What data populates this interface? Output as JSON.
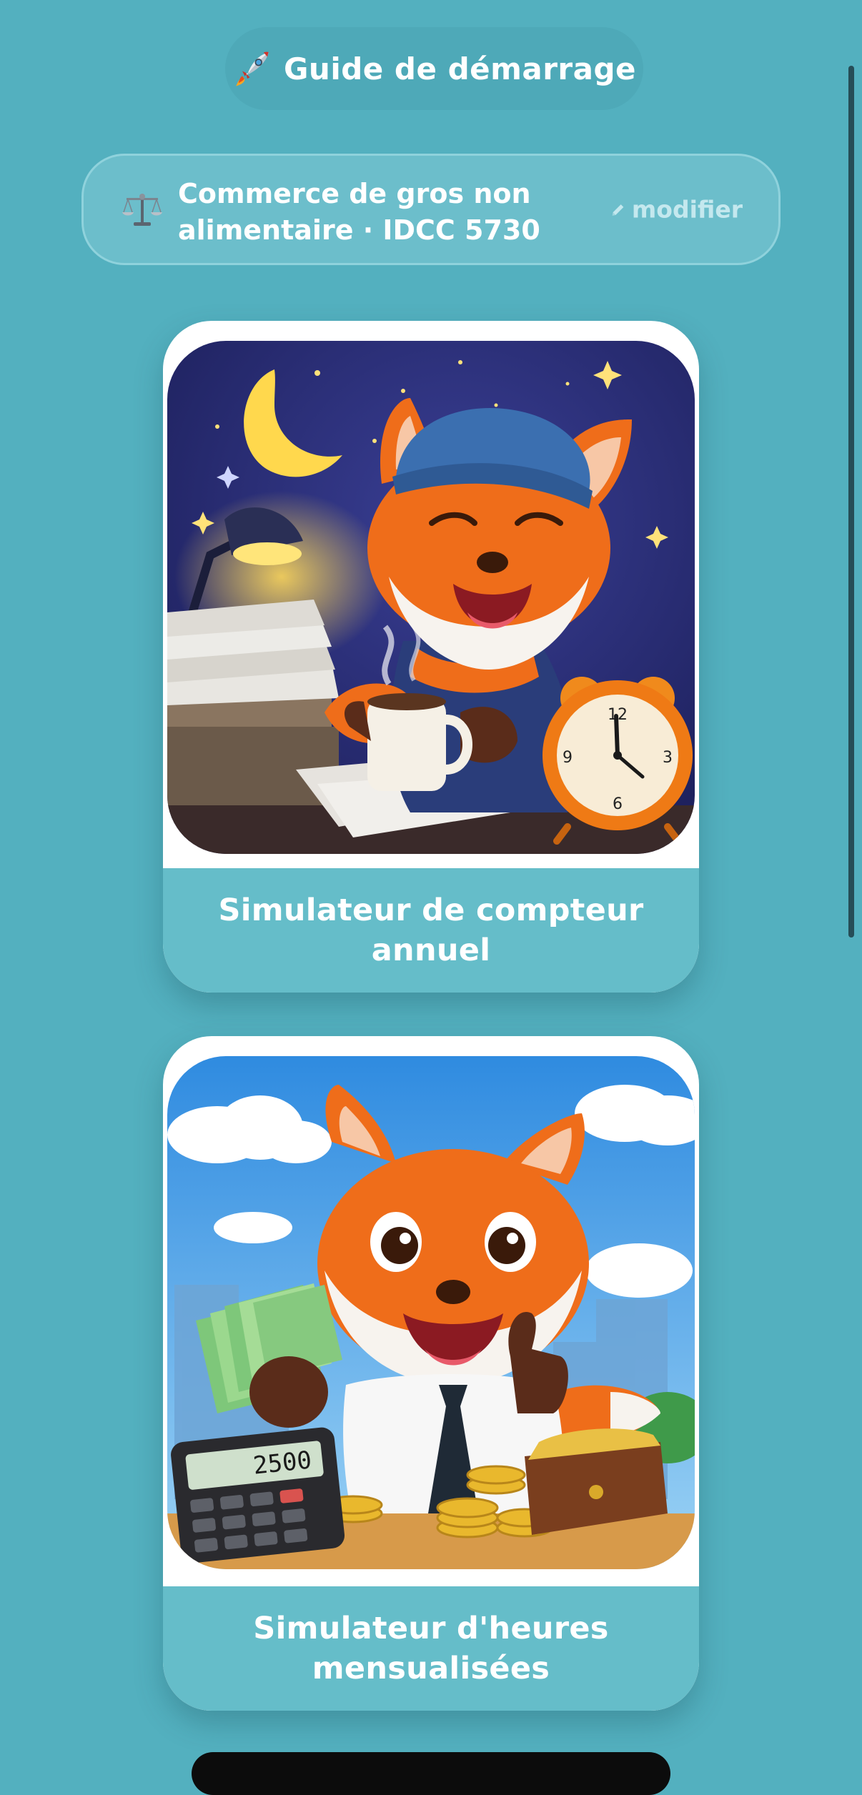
{
  "header": {
    "title": "Guide de démarrage"
  },
  "convention": {
    "label": "Commerce de gros non alimentaire · IDCC 5730",
    "edit_label": "modifier"
  },
  "cards": [
    {
      "title": "Simulateur de compteur annuel"
    },
    {
      "title": "Simulateur d'heures mensualisées",
      "calculator_display": "2500"
    }
  ],
  "clock": {
    "numbers": [
      "12",
      "3",
      "6",
      "9"
    ]
  },
  "colors": {
    "background": "#53b0bf",
    "caption": "#65bdc9",
    "fox": "#ef6d1a"
  },
  "icons": {
    "header": "rocket-icon",
    "convention": "scale-icon",
    "edit": "pencil-icon"
  }
}
